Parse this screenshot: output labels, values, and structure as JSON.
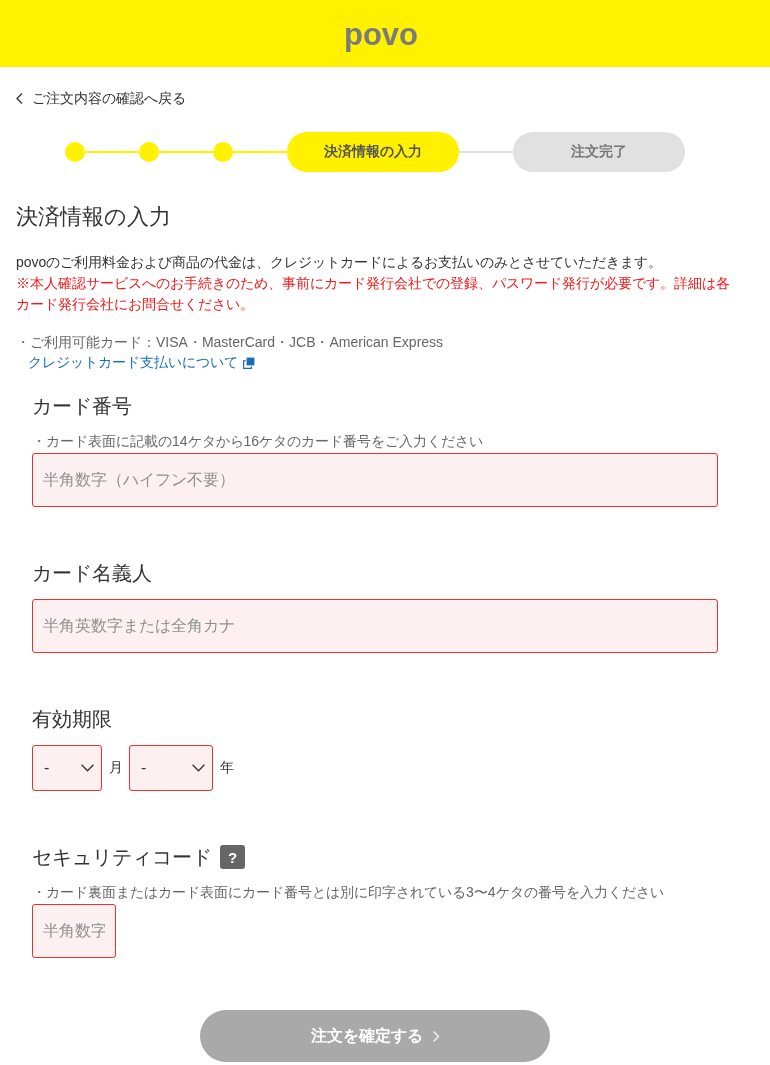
{
  "header": {
    "logo": "povo"
  },
  "back_link": {
    "label": "ご注文内容の確認へ戻る"
  },
  "stepper": {
    "steps": [
      {
        "completed": true,
        "current": false
      },
      {
        "completed": true,
        "current": false
      },
      {
        "completed": true,
        "current": false
      },
      {
        "completed": false,
        "current": true,
        "label": "決済情報の入力"
      },
      {
        "completed": false,
        "current": false,
        "label": "注文完了"
      }
    ]
  },
  "title": "決済情報の入力",
  "intro": {
    "text": "povoのご利用料金および商品の代金は、クレジットカードによるお支払いのみとさせていただきます。",
    "notice": "※本人確認サービスへのお手続きのため、事前にカード発行会社での登録、パスワード発行が必要です。詳細は各カード発行会社にお問合せください。"
  },
  "accepted_cards": "・ご利用可能カード：VISA・MasterCard・JCB・American Express",
  "payment_link": {
    "label": "クレジットカード支払いについて"
  },
  "fields": [
    {
      "kind": "text",
      "label": "カード番号",
      "hint": "・カード表面に記載の14ケタから16ケタのカード番号をご入力ください",
      "placeholder": "半角数字（ハイフン不要）",
      "invalid": true
    },
    {
      "kind": "text",
      "label": "カード名義人",
      "placeholder": "半角英数字または全角カナ",
      "invalid": true
    },
    {
      "kind": "select_pair",
      "label": "有効期限",
      "selects": [
        {
          "value": "-",
          "unit": "月",
          "invalid": true
        },
        {
          "value": "-",
          "unit": "年",
          "invalid": true
        }
      ]
    },
    {
      "kind": "short_text",
      "label": "セキュリティコード",
      "help": "?",
      "hint": "・カード裏面またはカード表面にカード番号とは別に印字されている3〜4ケタの番号を入力ください",
      "placeholder": "半角数字",
      "invalid": true
    }
  ],
  "submit_button": {
    "label": "注文を確定する",
    "disabled": true
  }
}
